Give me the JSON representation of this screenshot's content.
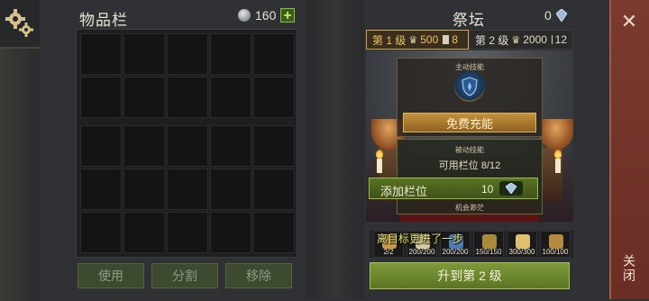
{
  "inventory": {
    "title": "物品栏",
    "coin_count": "160",
    "plus_label": "+",
    "buttons": {
      "use": "使用",
      "split": "分割",
      "remove": "移除"
    }
  },
  "altar": {
    "title": "祭坛",
    "gem_count": "0",
    "levels": [
      {
        "label": "第 1 级",
        "crowns": "500",
        "scrolls": "8"
      },
      {
        "label": "第 2 级",
        "crowns": "2000",
        "scrolls": "12"
      }
    ],
    "active_skill_label": "主动技能",
    "free_charge_label": "免费充能",
    "passive_skill_label": "被动技能",
    "slots_text": "可用栏位 8/12",
    "add_slot_label": "添加栏位",
    "add_slot_cost": "10",
    "chance_text": "机会渺茫",
    "toast": "离目标更进了一步",
    "requirements": [
      {
        "value": "2/2",
        "icon": "scroll-icon"
      },
      {
        "value": "200/200",
        "icon": "bone-icon"
      },
      {
        "value": "200/200",
        "icon": "gem-icon"
      },
      {
        "value": "150/150",
        "icon": "orb-icon"
      },
      {
        "value": "300/300",
        "icon": "candle-icon"
      },
      {
        "value": "100/100",
        "icon": "goblet-icon"
      }
    ],
    "upgrade_label": "升到第 2 级"
  },
  "close_label": "关闭",
  "colors": {
    "accent_gold": "#d1a44d",
    "accent_green": "#8fbd3a",
    "close_red": "#7a3a2e"
  }
}
